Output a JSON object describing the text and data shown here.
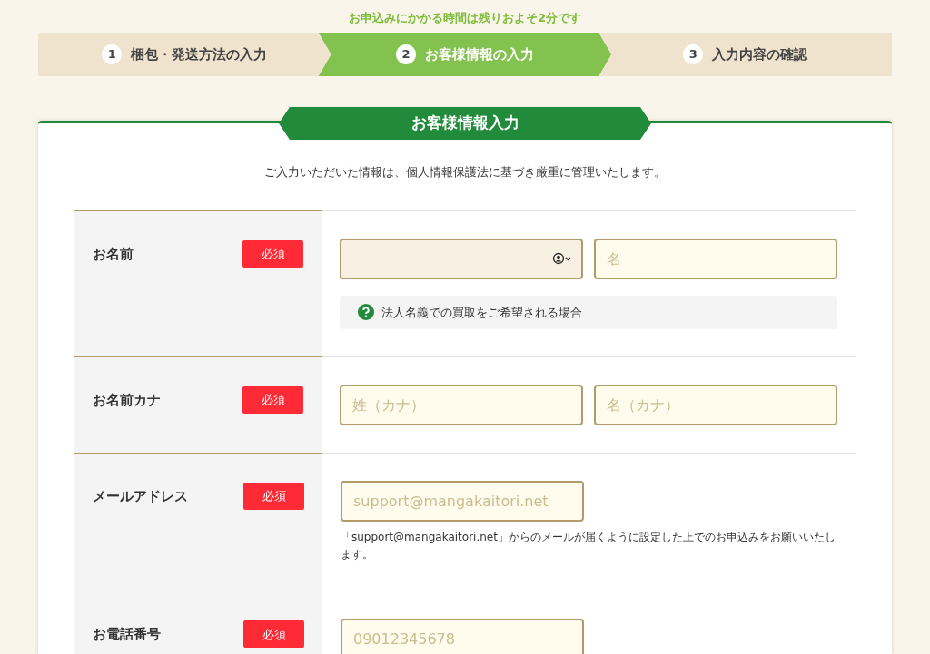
{
  "notice": "お申込みにかかる時間は残りおよそ2分です",
  "steps": [
    {
      "number": "1",
      "label": "梱包・発送方法の入力",
      "selected": false
    },
    {
      "number": "2",
      "label": "お客様情報の入力",
      "selected": true
    },
    {
      "number": "3",
      "label": "入力内容の確認",
      "selected": false
    }
  ],
  "section": {
    "title": "お客様情報入力",
    "intro": "ご入力いただいた情報は、個人情報保護法に基づき厳重に管理いたします。"
  },
  "rows": [
    {
      "label": "お名前",
      "badge": "必須",
      "fields": [
        {
          "kind": "autofill"
        },
        {
          "kind": "text",
          "placeholder": "名"
        }
      ],
      "help": "法人名義での買取をご希望される場合"
    },
    {
      "label": "お名前カナ",
      "badge": "必須",
      "fields": [
        {
          "kind": "text",
          "placeholder": "姓（カナ）"
        },
        {
          "kind": "text",
          "placeholder": "名（カナ）"
        }
      ]
    },
    {
      "label": "メールアドレス",
      "badge": "必須",
      "fields": [
        {
          "kind": "text",
          "placeholder": "support@mangakaitori.net"
        }
      ],
      "note": "「support@mangakaitori.net」からのメールが届くように設定した上でのお申込みをお願いいたします。"
    },
    {
      "label": "お電話番号",
      "badge": "必須",
      "fields": [
        {
          "kind": "text",
          "placeholder": "09012345678"
        }
      ]
    }
  ]
}
